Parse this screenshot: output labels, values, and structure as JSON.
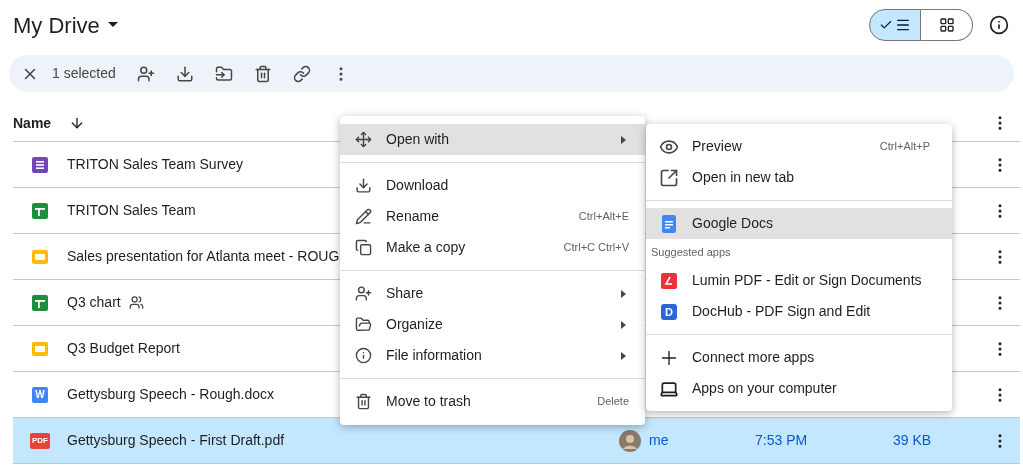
{
  "header": {
    "title": "My Drive",
    "view_toggle": [
      {
        "kind": "list",
        "selected": true
      },
      {
        "kind": "grid",
        "selected": false
      }
    ]
  },
  "selection_bar": {
    "count_label": "1 selected"
  },
  "table": {
    "columns": [
      {
        "label": "Name"
      }
    ],
    "rows": [
      {
        "kind": "form",
        "name": "TRITON Sales Team Survey",
        "shared": false,
        "selected": false
      },
      {
        "kind": "sheet",
        "name": "TRITON Sales Team",
        "shared": false,
        "selected": false
      },
      {
        "kind": "slides",
        "name": "Sales presentation for Atlanta meet - ROUG",
        "shared": false,
        "selected": false
      },
      {
        "kind": "sheet",
        "name": "Q3 chart",
        "shared": true,
        "selected": false
      },
      {
        "kind": "slides",
        "name": "Q3 Budget Report",
        "shared": false,
        "selected": false
      },
      {
        "kind": "word",
        "icon_text": "W",
        "name": "Gettysburg Speech - Rough.docx",
        "shared": false,
        "selected": false
      },
      {
        "kind": "pdf",
        "icon_text": "PDF",
        "name": "Gettysburg Speech - First Draft.pdf",
        "shared": false,
        "selected": true,
        "owner": "me",
        "modified": "7:53 PM",
        "size": "39 KB"
      }
    ]
  },
  "context_menu": {
    "items": [
      {
        "kind": "item",
        "label": "Open with",
        "has_submenu": true,
        "selected": true
      },
      {
        "kind": "divider"
      },
      {
        "kind": "item",
        "label": "Download",
        "has_submenu": false,
        "selected": false
      },
      {
        "kind": "item",
        "label": "Rename",
        "shortcut": "Ctrl+Alt+E",
        "has_submenu": false,
        "selected": false
      },
      {
        "kind": "item",
        "label": "Make a copy",
        "shortcut": "Ctrl+C Ctrl+V",
        "has_submenu": false,
        "selected": false
      },
      {
        "kind": "divider"
      },
      {
        "kind": "item",
        "label": "Share",
        "has_submenu": true,
        "selected": false
      },
      {
        "kind": "item",
        "label": "Organize",
        "has_submenu": true,
        "selected": false
      },
      {
        "kind": "item",
        "label": "File information",
        "has_submenu": true,
        "selected": false
      },
      {
        "kind": "divider"
      },
      {
        "kind": "item",
        "label": "Move to trash",
        "shortcut": "Delete",
        "has_submenu": false,
        "selected": false
      }
    ]
  },
  "open_with_menu": {
    "items": [
      {
        "kind": "preview",
        "label": "Preview",
        "shortcut": "Ctrl+Alt+P",
        "selected": false
      },
      {
        "kind": "new-tab",
        "label": "Open in new tab",
        "selected": false
      },
      {
        "kind": "divider"
      },
      {
        "kind": "docs",
        "label": "Google Docs",
        "selected": true
      },
      {
        "kind": "heading",
        "label": "Suggested apps"
      },
      {
        "kind": "lumin",
        "label": "Lumin PDF - Edit or Sign Documents",
        "selected": false
      },
      {
        "kind": "dochub",
        "icon_text": "D",
        "label": "DocHub - PDF Sign and Edit",
        "selected": false
      },
      {
        "kind": "divider"
      },
      {
        "kind": "connect",
        "label": "Connect more apps",
        "selected": false
      },
      {
        "kind": "computer",
        "label": "Apps on your computer",
        "selected": false
      }
    ]
  }
}
